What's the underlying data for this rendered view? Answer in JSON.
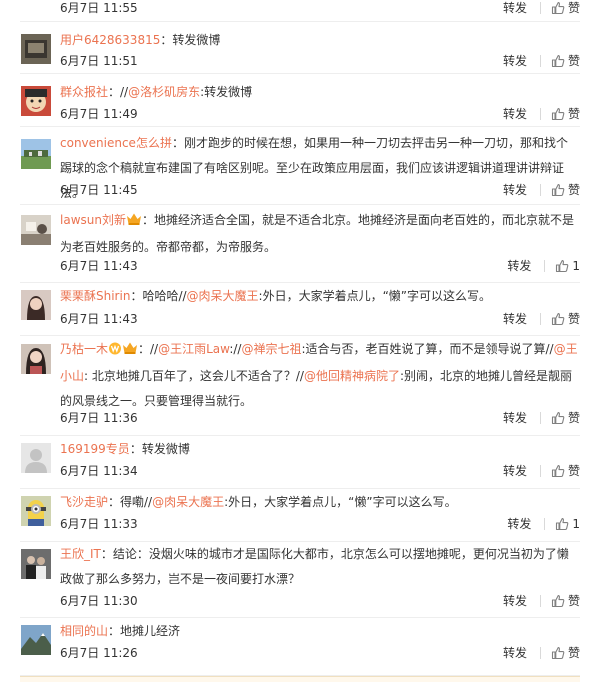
{
  "comments": [
    {
      "user": "",
      "text": "",
      "time": "6月7日 11:55",
      "repost": "转发",
      "like_label": "赞",
      "avatar": "none"
    },
    {
      "user": "用户6428633815",
      "text": "：转发微博",
      "time": "6月7日 11:51",
      "repost": "转发",
      "like_label": "赞",
      "avatar": "dark"
    },
    {
      "user": "群众报社",
      "text": "：//@洛杉矶房东:转发微博",
      "time": "6月7日 11:49",
      "repost": "转发",
      "like_label": "赞",
      "avatar": "cartoon"
    },
    {
      "user": "convenience怎么拼",
      "text": "：刚才跑步的时候在想，如果用一种一刀切去抨击另一种一刀切，那和找个踢球的念个稿就宣布建国了有啥区别呢。至少在政策应用层面，我们应该讲逻辑讲道理讲讲辩证法。",
      "time": "6月7日 11:45",
      "repost": "转发",
      "like_label": "赞",
      "avatar": "landscape"
    },
    {
      "user": "lawsun刘新",
      "text": "：地摊经济适合全国，就是不适合北京。地摊经济是面向老百姓的，而北京就不是为老百姓服务的。帝都帝都，为帝服务。",
      "time": "6月7日 11:43",
      "repost": "转发",
      "like_label": "1",
      "avatar": "room"
    },
    {
      "user": "栗栗酥Shirin",
      "text": "：哈哈哈//@肉呆大魔王:外日，大家学着点儿，“懒”字可以这么写。",
      "time": "6月7日 11:43",
      "repost": "转发",
      "like_label": "赞",
      "avatar": "girl"
    },
    {
      "user": "乃枯一木",
      "text": "：//@王江雨Law://@禅宗七祖:适合与否，老百姓说了算，而不是领导说了算//@王小山: 北京地摊几百年了，这会儿不适合了？//@他回精神病院了:别闹，北京的地摊儿曾经是靓丽的风景线之一。只要管理得当就行。",
      "time": "6月7日 11:36",
      "repost": "转发",
      "like_label": "赞",
      "avatar": "girl2"
    },
    {
      "user": "169199专员",
      "text": "：转发微博",
      "time": "6月7日 11:34",
      "repost": "转发",
      "like_label": "赞",
      "avatar": "default"
    },
    {
      "user": "飞沙走驴",
      "text": "：得嘞//@肉呆大魔王:外日，大家学着点儿，“懒”字可以这么写。",
      "time": "6月7日 11:33",
      "repost": "转发",
      "like_label": "1",
      "avatar": "minion"
    },
    {
      "user": "王欣_IT",
      "text": "：结论：没烟火味的城市才是国际化大都市，北京怎么可以摆地摊呢，更何况当初为了懒政做了那么多努力，岂不是一夜间要打水漂？",
      "time": "6月7日 11:30",
      "repost": "转发",
      "like_label": "赞",
      "avatar": "people"
    },
    {
      "user": "相同的山",
      "text": "：地摊儿经济",
      "time": "6月7日 11:26",
      "repost": "转发",
      "like_label": "赞",
      "avatar": "mountain"
    }
  ],
  "colors": {
    "username": "#eb7350",
    "text": "#333333",
    "divider": "#eeeeee"
  },
  "icons": {
    "like": "thumbs-up-icon",
    "vip": "vip-badge-icon",
    "crown": "crown-badge-icon"
  }
}
